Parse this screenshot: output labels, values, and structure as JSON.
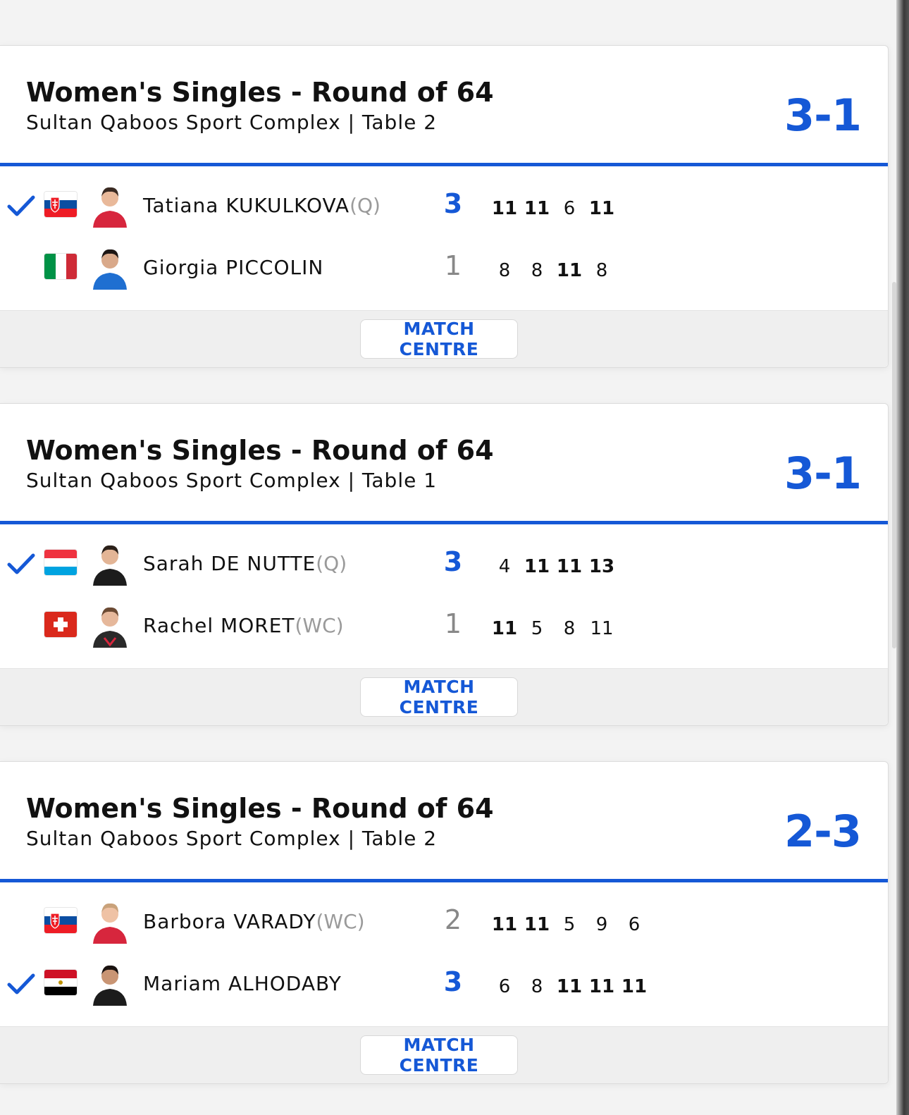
{
  "accent_color": "#1558d6",
  "matches": [
    {
      "title": "Women's Singles - Round of 64",
      "venue": "Sultan Qaboos Sport Complex | Table 2",
      "final_score": "3-1",
      "button_label": "MATCH CENTRE",
      "players": [
        {
          "name": "Tatiana KUKULKOVA",
          "tag": "(Q)",
          "flag": "slovakia-flag",
          "games": "3",
          "winner": true,
          "sets": [
            "11",
            "11",
            "6",
            "11"
          ]
        },
        {
          "name": "Giorgia PICCOLIN",
          "tag": "",
          "flag": "italy-flag",
          "games": "1",
          "winner": false,
          "sets": [
            "8",
            "8",
            "11",
            "8"
          ]
        }
      ]
    },
    {
      "title": "Women's Singles - Round of 64",
      "venue": "Sultan Qaboos Sport Complex | Table 1",
      "final_score": "3-1",
      "button_label": "MATCH CENTRE",
      "players": [
        {
          "name": "Sarah DE NUTTE",
          "tag": "(Q)",
          "flag": "luxembourg-flag",
          "games": "3",
          "winner": true,
          "sets": [
            "4",
            "11",
            "11",
            "13"
          ]
        },
        {
          "name": "Rachel MORET",
          "tag": "(WC)",
          "flag": "switzerland-flag",
          "games": "1",
          "winner": false,
          "sets": [
            "11",
            "5",
            "8",
            "11"
          ]
        }
      ]
    },
    {
      "title": "Women's Singles - Round of 64",
      "venue": "Sultan Qaboos Sport Complex | Table 2",
      "final_score": "2-3",
      "button_label": "MATCH CENTRE",
      "players": [
        {
          "name": "Barbora VARADY",
          "tag": "(WC)",
          "flag": "slovakia-flag",
          "games": "2",
          "winner": false,
          "sets": [
            "11",
            "11",
            "5",
            "9",
            "6"
          ]
        },
        {
          "name": "Mariam ALHODABY",
          "tag": "",
          "flag": "egypt-flag",
          "games": "3",
          "winner": true,
          "sets": [
            "6",
            "8",
            "11",
            "11",
            "11"
          ]
        }
      ]
    }
  ]
}
